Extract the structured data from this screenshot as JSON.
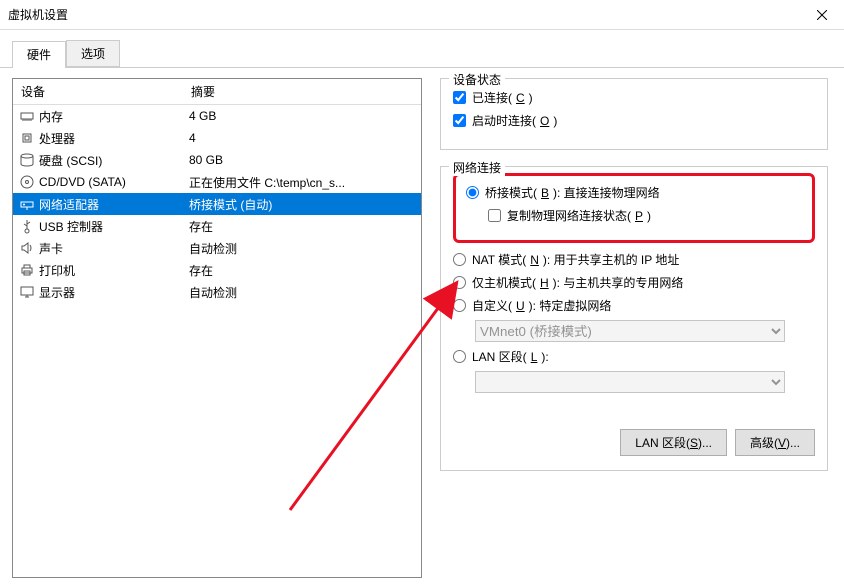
{
  "window": {
    "title": "虚拟机设置"
  },
  "tabs": {
    "hardware": "硬件",
    "options": "选项"
  },
  "deviceList": {
    "headers": {
      "device": "设备",
      "summary": "摘要"
    },
    "rows": [
      {
        "name": "内存",
        "summary": "4 GB",
        "icon": "memory"
      },
      {
        "name": "处理器",
        "summary": "4",
        "icon": "cpu"
      },
      {
        "name": "硬盘 (SCSI)",
        "summary": "80 GB",
        "icon": "disk"
      },
      {
        "name": "CD/DVD (SATA)",
        "summary": "正在使用文件 C:\\temp\\cn_s...",
        "icon": "cd"
      },
      {
        "name": "网络适配器",
        "summary": "桥接模式 (自动)",
        "icon": "network",
        "selected": true
      },
      {
        "name": "USB 控制器",
        "summary": "存在",
        "icon": "usb"
      },
      {
        "name": "声卡",
        "summary": "自动检测",
        "icon": "sound"
      },
      {
        "name": "打印机",
        "summary": "存在",
        "icon": "printer"
      },
      {
        "name": "显示器",
        "summary": "自动检测",
        "icon": "display"
      }
    ]
  },
  "status": {
    "title": "设备状态",
    "connected": "已连接(",
    "connectedKey": "C",
    "connectedEnd": ")",
    "connectOnPowerOn": "启动时连接(",
    "connectOnPowerOnKey": "O",
    "connectOnPowerOnEnd": ")"
  },
  "network": {
    "title": "网络连接",
    "bridged": "桥接模式(",
    "bridgedKey": "B",
    "bridgedEnd": "): 直接连接物理网络",
    "replicate": "复制物理网络连接状态(",
    "replicateKey": "P",
    "replicateEnd": ")",
    "nat": "NAT 模式(",
    "natKey": "N",
    "natEnd": "): 用于共享主机的 IP 地址",
    "hostonly": "仅主机模式(",
    "hostonlyKey": "H",
    "hostonlyEnd": "): 与主机共享的专用网络",
    "custom": "自定义(",
    "customKey": "U",
    "customEnd": "): 特定虚拟网络",
    "customValue": "VMnet0 (桥接模式)",
    "lan": "LAN 区段(",
    "lanKey": "L",
    "lanEnd": "):",
    "lanValue": ""
  },
  "buttons": {
    "lanSegments": "LAN 区段(",
    "lanSegmentsKey": "S",
    "lanSegmentsEnd": ")...",
    "advanced": "高级(",
    "advancedKey": "V",
    "advancedEnd": ")..."
  }
}
